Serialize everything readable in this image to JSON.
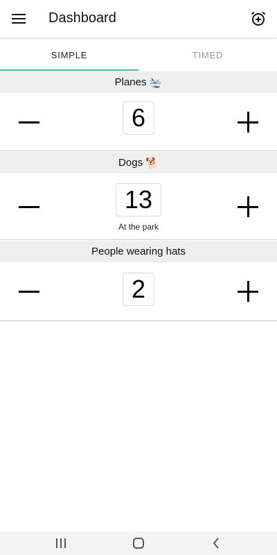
{
  "app_bar": {
    "title": "Dashboard",
    "menu_icon": "hamburger-menu-icon",
    "action_icon": "add-alarm-icon"
  },
  "tabs": [
    {
      "label": "SIMPLE",
      "active": true
    },
    {
      "label": "TIMED",
      "active": false
    }
  ],
  "counters": [
    {
      "name": "Planes",
      "emoji": "🛬",
      "count": "6",
      "note": ""
    },
    {
      "name": "Dogs",
      "emoji": "🐕",
      "count": "13",
      "note": "At the park"
    },
    {
      "name": "People wearing hats",
      "emoji": "",
      "count": "2",
      "note": ""
    }
  ],
  "controls": {
    "decrement_icon": "minus-icon",
    "increment_icon": "plus-icon"
  },
  "system_nav": {
    "recents_icon": "recents-icon",
    "home_icon": "home-icon",
    "back_icon": "back-icon"
  },
  "colors": {
    "accent": "#2bc2b0",
    "header_bg": "#eeeeee",
    "divider": "#c9c9c9"
  }
}
